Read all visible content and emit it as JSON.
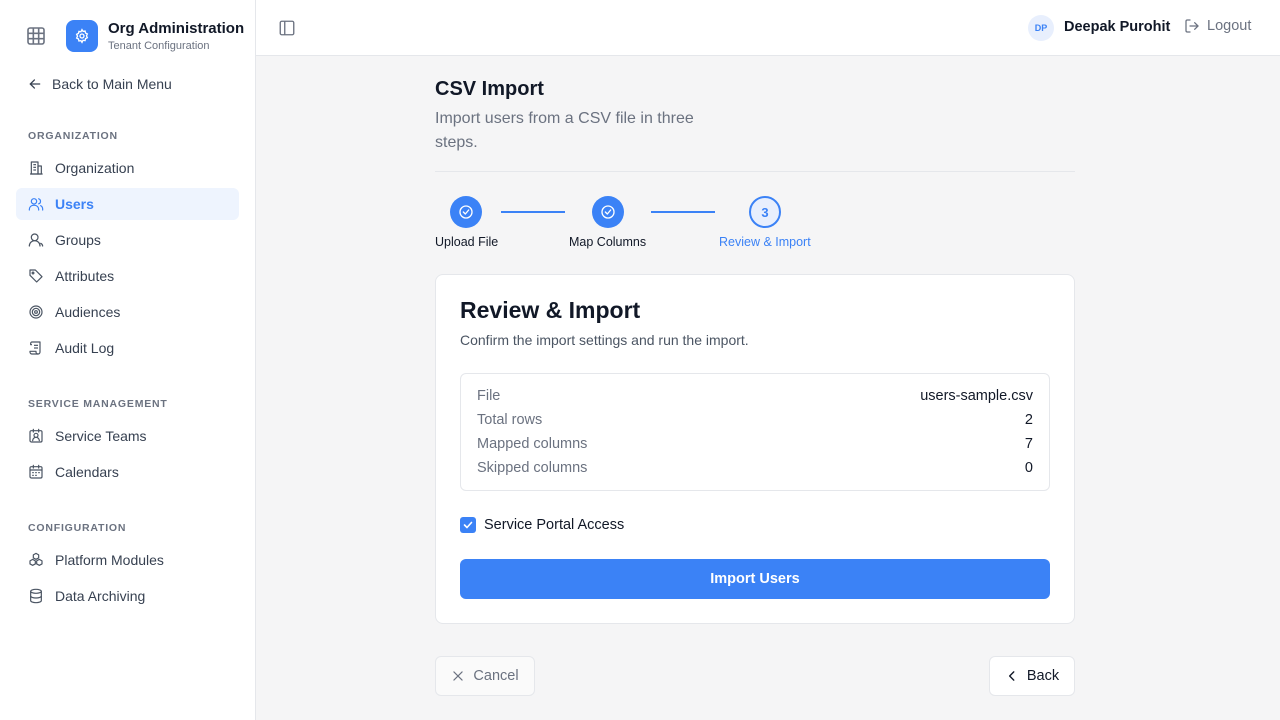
{
  "brand": {
    "title": "Org Administration",
    "subtitle": "Tenant Configuration",
    "accent": "#3b82f6"
  },
  "sidebar": {
    "back_label": "Back to Main Menu",
    "sections": [
      {
        "label": "ORGANIZATION",
        "items": [
          {
            "label": "Organization",
            "icon": "building-icon",
            "active": false
          },
          {
            "label": "Users",
            "icon": "users-icon",
            "active": true
          },
          {
            "label": "Groups",
            "icon": "group-icon",
            "active": false
          },
          {
            "label": "Attributes",
            "icon": "tag-icon",
            "active": false
          },
          {
            "label": "Audiences",
            "icon": "target-icon",
            "active": false
          },
          {
            "label": "Audit Log",
            "icon": "scroll-icon",
            "active": false
          }
        ]
      },
      {
        "label": "SERVICE MANAGEMENT",
        "items": [
          {
            "label": "Service Teams",
            "icon": "team-badge-icon",
            "active": false
          },
          {
            "label": "Calendars",
            "icon": "calendar-icon",
            "active": false
          }
        ]
      },
      {
        "label": "CONFIGURATION",
        "items": [
          {
            "label": "Platform Modules",
            "icon": "modules-icon",
            "active": false
          },
          {
            "label": "Data Archiving",
            "icon": "database-icon",
            "active": false
          }
        ]
      }
    ]
  },
  "header": {
    "avatar_initials": "DP",
    "user_name": "Deepak Purohit",
    "logout_label": "Logout"
  },
  "page": {
    "title": "CSV Import",
    "description": "Import users from a CSV file in three steps."
  },
  "steps": [
    {
      "label": "Upload File",
      "state": "done"
    },
    {
      "label": "Map Columns",
      "state": "done"
    },
    {
      "label": "Review & Import",
      "state": "current",
      "number": "3"
    }
  ],
  "review": {
    "title": "Review & Import",
    "description": "Confirm the import settings and run the import.",
    "rows": [
      {
        "label": "File",
        "value": "users-sample.csv"
      },
      {
        "label": "Total rows",
        "value": "2"
      },
      {
        "label": "Mapped columns",
        "value": "7"
      },
      {
        "label": "Skipped columns",
        "value": "0"
      }
    ],
    "checkbox_label": "Service Portal Access",
    "checkbox_checked": true,
    "import_label": "Import Users"
  },
  "footer": {
    "cancel_label": "Cancel",
    "back_label": "Back"
  }
}
